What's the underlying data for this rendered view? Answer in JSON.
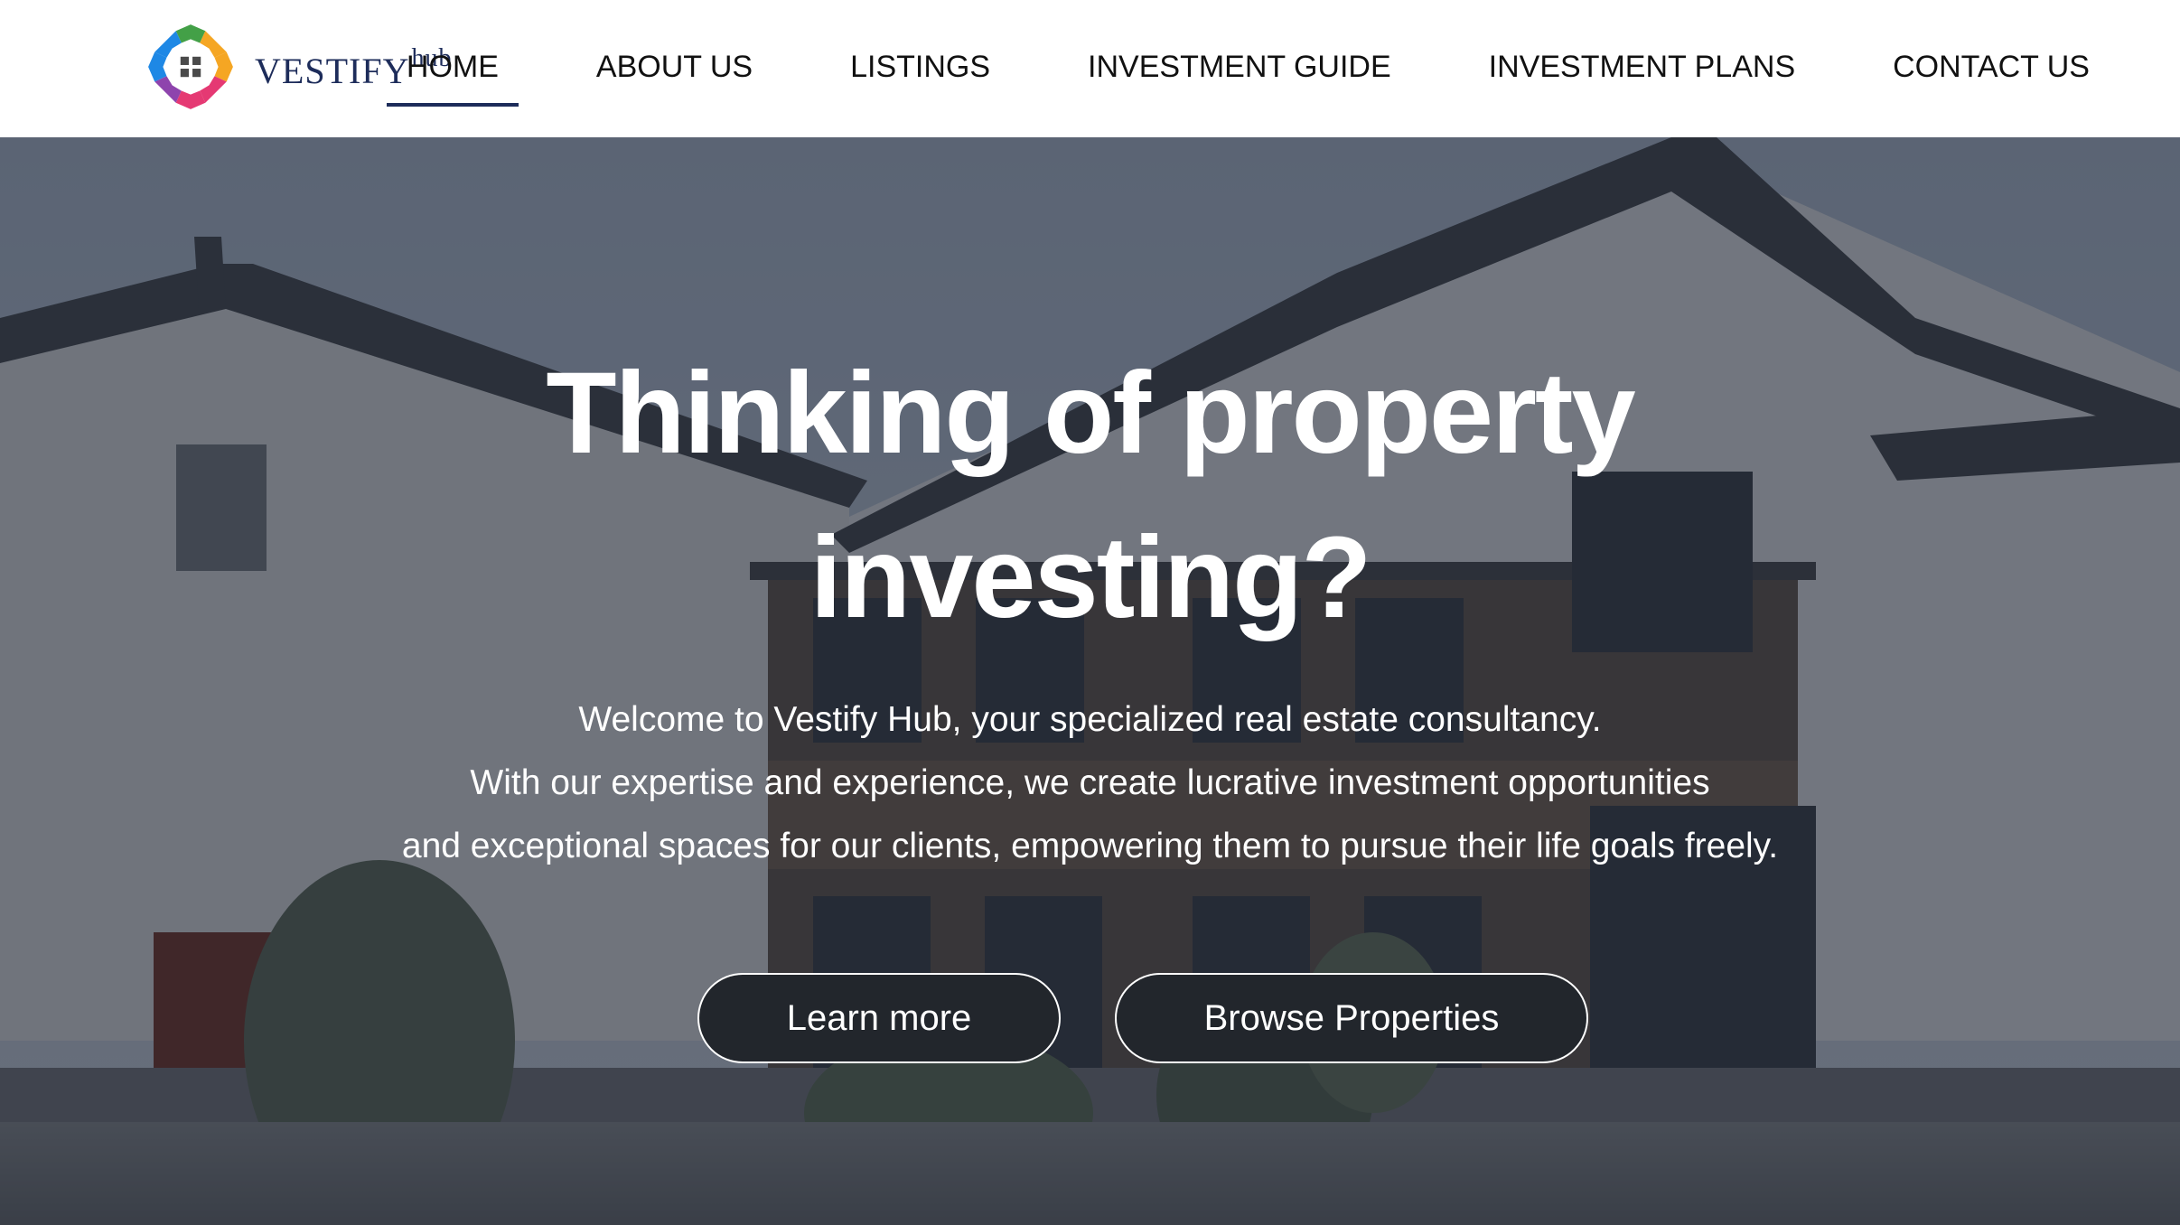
{
  "brand": {
    "name": "VESTIFY",
    "suffix": "hub",
    "colors": {
      "navy": "#1d2c5a",
      "blue": "#1e88e5",
      "green": "#43a047",
      "orange": "#f5a623",
      "pink": "#e53973"
    }
  },
  "nav": {
    "items": [
      {
        "label": "HOME",
        "active": true
      },
      {
        "label": "ABOUT US",
        "active": false
      },
      {
        "label": "LISTINGS",
        "active": false
      },
      {
        "label": "INVESTMENT GUIDE",
        "active": false
      },
      {
        "label": "INVESTMENT PLANS",
        "active": false
      },
      {
        "label": "CONTACT US",
        "active": false
      }
    ]
  },
  "hero": {
    "title_lines": [
      "Thinking of property",
      "investing?"
    ],
    "subtitle_lines": [
      "Welcome to Vestify Hub, your specialized real estate consultancy.",
      "With our expertise and experience, we create lucrative investment opportunities",
      "and exceptional spaces for our clients, empowering them to pursue their life goals freely."
    ],
    "buttons": {
      "learn_more": "Learn more",
      "browse": "Browse Properties"
    },
    "background": "traditional white-walled building with dark tiled roofs, trees in front"
  }
}
